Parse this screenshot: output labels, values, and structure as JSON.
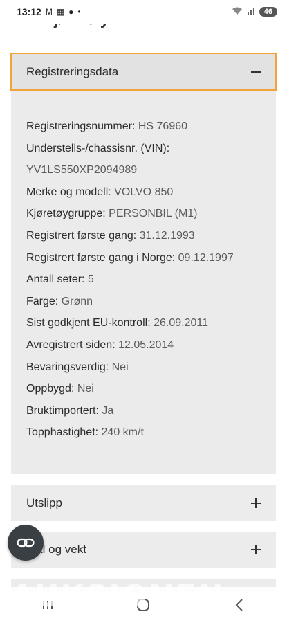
{
  "status_bar": {
    "time": "13:12",
    "battery": "46"
  },
  "page": {
    "heading": "Om kjøretøyet"
  },
  "panel": {
    "title": "Registreringsdata",
    "rows": [
      {
        "label": "Registreringsnummer:",
        "value": "HS 76960"
      },
      {
        "label": "Understells-/chassisnr. (VIN):",
        "value": ""
      },
      {
        "label": "",
        "value": "YV1LS550XP2094989"
      },
      {
        "label": "Merke og modell:",
        "value": "VOLVO 850"
      },
      {
        "label": "Kjøretøygruppe:",
        "value": "PERSONBIL (M1)"
      },
      {
        "label": "Registrert første gang:",
        "value": "31.12.1993"
      },
      {
        "label": "Registrert første gang i Norge:",
        "value": "09.12.1997"
      },
      {
        "label": "Antall seter:",
        "value": "5"
      },
      {
        "label": "Farge:",
        "value": "Grønn"
      },
      {
        "label": "Sist godkjent EU-kontroll:",
        "value": "26.09.2011"
      },
      {
        "label": "Avregistrert siden:",
        "value": "12.05.2014"
      },
      {
        "label": "Bevaringsverdig:",
        "value": "Nei"
      },
      {
        "label": "Oppbygd:",
        "value": "Nei"
      },
      {
        "label": "Bruktimportert:",
        "value": "Ja"
      },
      {
        "label": "Topphastighet:",
        "value": "240 km/t"
      }
    ]
  },
  "accordions": {
    "utslipp": "Utslipp",
    "mal_og_vekt": "Mål og vekt"
  },
  "watermark": "AUKSJONEN"
}
